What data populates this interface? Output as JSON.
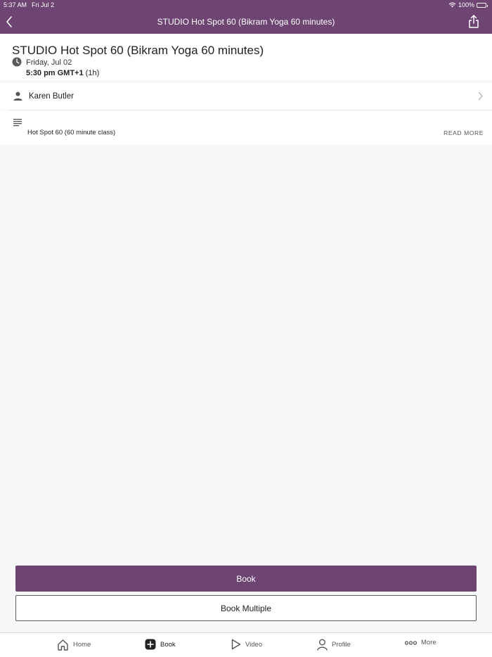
{
  "status_bar": {
    "time": "5:37 AM",
    "date": "Fri Jul 2",
    "battery": "100%",
    "icons": [
      "wifi-icon",
      "battery-icon"
    ]
  },
  "nav": {
    "title": "STUDIO Hot Spot 60 (Bikram Yoga 60 minutes)",
    "icons": [
      "back-chevron-icon",
      "share-icon"
    ]
  },
  "class": {
    "title": "STUDIO Hot Spot 60 (Bikram Yoga 60 minutes)",
    "date": "Friday, Jul 02",
    "time": "5:30 pm GMT+1",
    "duration": "(1h)"
  },
  "instructor": {
    "name": "Karen Butler"
  },
  "description": {
    "text": "Hot Spot 60 (60 minute class)",
    "read_more": "READ MORE"
  },
  "actions": {
    "book": "Book",
    "book_multiple": "Book Multiple"
  },
  "tabs": [
    {
      "label": "Home",
      "icon": "home-icon"
    },
    {
      "label": "Book",
      "icon": "book-plus-icon",
      "active": true
    },
    {
      "label": "Video",
      "icon": "play-icon"
    },
    {
      "label": "Profile",
      "icon": "person-icon"
    },
    {
      "label": "More",
      "icon": "more-dots-icon"
    }
  ],
  "colors": {
    "brand": "#6d4472",
    "background": "#f7f8fa"
  }
}
